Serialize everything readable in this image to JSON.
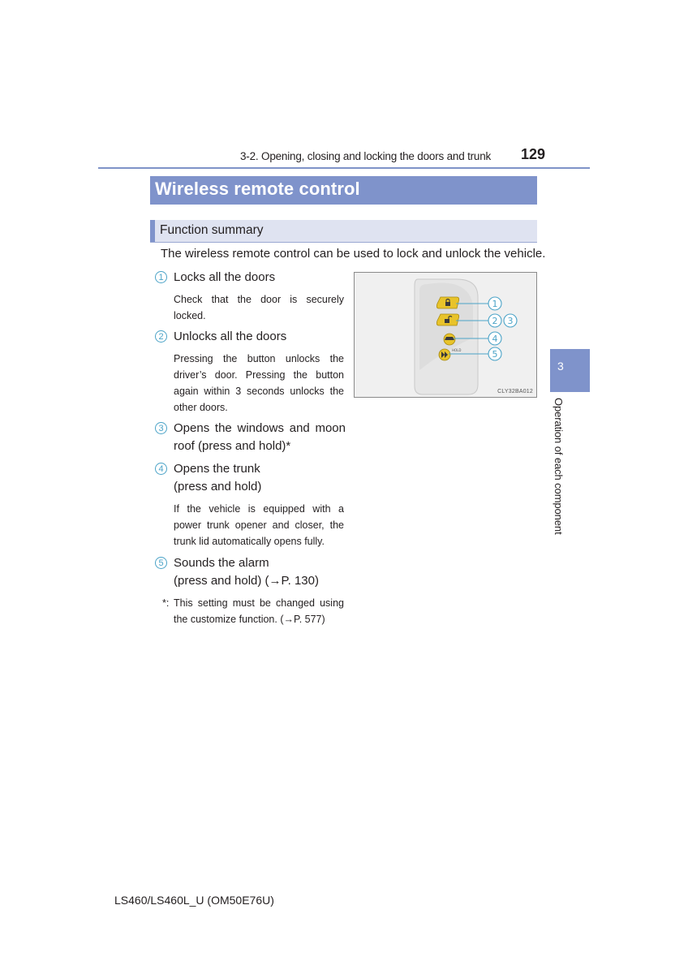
{
  "header": {
    "section": "3-2. Opening, closing and locking the doors and trunk",
    "page_number": "129"
  },
  "title": "Wireless remote control",
  "subsection": "Function summary",
  "intro": "The wireless remote control can be used to lock and unlock the vehicle.",
  "items": [
    {
      "num": "1",
      "title": "Locks all the doors",
      "note": "Check that the door is securely locked."
    },
    {
      "num": "2",
      "title": "Unlocks all the doors",
      "note": "Pressing the button unlocks the driver’s door. Pressing the button again within 3 seconds unlocks the other doors."
    },
    {
      "num": "3",
      "title": "Opens the windows and moon roof (press and hold)*"
    },
    {
      "num": "4",
      "title": "Opens the trunk\n(press and hold)",
      "note": "If the vehicle is equipped with a power trunk opener and closer, the trunk lid automatically opens fully."
    },
    {
      "num": "5",
      "title": "Sounds the alarm\n(press and hold) (→P. 130)"
    }
  ],
  "footnote": {
    "marker": "*:",
    "text": "This setting must be changed using the customize function. (→P. 577)"
  },
  "figure": {
    "code": "CLY32BA012",
    "callouts": [
      "1",
      "2",
      "3",
      "4",
      "5"
    ],
    "button_label_hold": "HOLD",
    "colors": {
      "key_body": "#e4e4e4",
      "button": "#e8c32a",
      "callout": "#4ba3c7"
    }
  },
  "side_tab": {
    "number": "3",
    "label": "Operation of each component"
  },
  "footer": "LS460/LS460L_U (OM50E76U)",
  "colors": {
    "accent": "#7f93cb",
    "sub_bg": "#dfe3f1",
    "callout": "#4ba3c7"
  }
}
